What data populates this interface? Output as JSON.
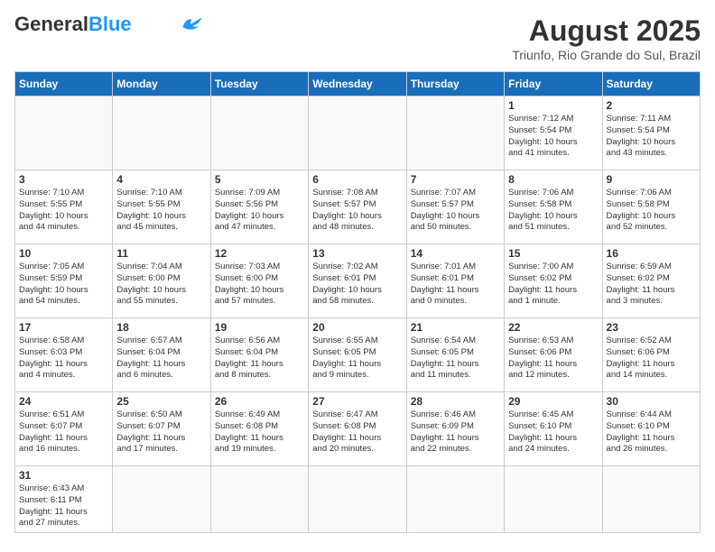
{
  "header": {
    "logo_general": "General",
    "logo_blue": "Blue",
    "month_year": "August 2025",
    "location": "Triunfo, Rio Grande do Sul, Brazil"
  },
  "days_of_week": [
    "Sunday",
    "Monday",
    "Tuesday",
    "Wednesday",
    "Thursday",
    "Friday",
    "Saturday"
  ],
  "weeks": [
    [
      {
        "day": "",
        "info": ""
      },
      {
        "day": "",
        "info": ""
      },
      {
        "day": "",
        "info": ""
      },
      {
        "day": "",
        "info": ""
      },
      {
        "day": "",
        "info": ""
      },
      {
        "day": "1",
        "info": "Sunrise: 7:12 AM\nSunset: 5:54 PM\nDaylight: 10 hours\nand 41 minutes."
      },
      {
        "day": "2",
        "info": "Sunrise: 7:11 AM\nSunset: 5:54 PM\nDaylight: 10 hours\nand 43 minutes."
      }
    ],
    [
      {
        "day": "3",
        "info": "Sunrise: 7:10 AM\nSunset: 5:55 PM\nDaylight: 10 hours\nand 44 minutes."
      },
      {
        "day": "4",
        "info": "Sunrise: 7:10 AM\nSunset: 5:55 PM\nDaylight: 10 hours\nand 45 minutes."
      },
      {
        "day": "5",
        "info": "Sunrise: 7:09 AM\nSunset: 5:56 PM\nDaylight: 10 hours\nand 47 minutes."
      },
      {
        "day": "6",
        "info": "Sunrise: 7:08 AM\nSunset: 5:57 PM\nDaylight: 10 hours\nand 48 minutes."
      },
      {
        "day": "7",
        "info": "Sunrise: 7:07 AM\nSunset: 5:57 PM\nDaylight: 10 hours\nand 50 minutes."
      },
      {
        "day": "8",
        "info": "Sunrise: 7:06 AM\nSunset: 5:58 PM\nDaylight: 10 hours\nand 51 minutes."
      },
      {
        "day": "9",
        "info": "Sunrise: 7:06 AM\nSunset: 5:58 PM\nDaylight: 10 hours\nand 52 minutes."
      }
    ],
    [
      {
        "day": "10",
        "info": "Sunrise: 7:05 AM\nSunset: 5:59 PM\nDaylight: 10 hours\nand 54 minutes."
      },
      {
        "day": "11",
        "info": "Sunrise: 7:04 AM\nSunset: 6:00 PM\nDaylight: 10 hours\nand 55 minutes."
      },
      {
        "day": "12",
        "info": "Sunrise: 7:03 AM\nSunset: 6:00 PM\nDaylight: 10 hours\nand 57 minutes."
      },
      {
        "day": "13",
        "info": "Sunrise: 7:02 AM\nSunset: 6:01 PM\nDaylight: 10 hours\nand 58 minutes."
      },
      {
        "day": "14",
        "info": "Sunrise: 7:01 AM\nSunset: 6:01 PM\nDaylight: 11 hours\nand 0 minutes."
      },
      {
        "day": "15",
        "info": "Sunrise: 7:00 AM\nSunset: 6:02 PM\nDaylight: 11 hours\nand 1 minute."
      },
      {
        "day": "16",
        "info": "Sunrise: 6:59 AM\nSunset: 6:02 PM\nDaylight: 11 hours\nand 3 minutes."
      }
    ],
    [
      {
        "day": "17",
        "info": "Sunrise: 6:58 AM\nSunset: 6:03 PM\nDaylight: 11 hours\nand 4 minutes."
      },
      {
        "day": "18",
        "info": "Sunrise: 6:57 AM\nSunset: 6:04 PM\nDaylight: 11 hours\nand 6 minutes."
      },
      {
        "day": "19",
        "info": "Sunrise: 6:56 AM\nSunset: 6:04 PM\nDaylight: 11 hours\nand 8 minutes."
      },
      {
        "day": "20",
        "info": "Sunrise: 6:55 AM\nSunset: 6:05 PM\nDaylight: 11 hours\nand 9 minutes."
      },
      {
        "day": "21",
        "info": "Sunrise: 6:54 AM\nSunset: 6:05 PM\nDaylight: 11 hours\nand 11 minutes."
      },
      {
        "day": "22",
        "info": "Sunrise: 6:53 AM\nSunset: 6:06 PM\nDaylight: 11 hours\nand 12 minutes."
      },
      {
        "day": "23",
        "info": "Sunrise: 6:52 AM\nSunset: 6:06 PM\nDaylight: 11 hours\nand 14 minutes."
      }
    ],
    [
      {
        "day": "24",
        "info": "Sunrise: 6:51 AM\nSunset: 6:07 PM\nDaylight: 11 hours\nand 16 minutes."
      },
      {
        "day": "25",
        "info": "Sunrise: 6:50 AM\nSunset: 6:07 PM\nDaylight: 11 hours\nand 17 minutes."
      },
      {
        "day": "26",
        "info": "Sunrise: 6:49 AM\nSunset: 6:08 PM\nDaylight: 11 hours\nand 19 minutes."
      },
      {
        "day": "27",
        "info": "Sunrise: 6:47 AM\nSunset: 6:08 PM\nDaylight: 11 hours\nand 20 minutes."
      },
      {
        "day": "28",
        "info": "Sunrise: 6:46 AM\nSunset: 6:09 PM\nDaylight: 11 hours\nand 22 minutes."
      },
      {
        "day": "29",
        "info": "Sunrise: 6:45 AM\nSunset: 6:10 PM\nDaylight: 11 hours\nand 24 minutes."
      },
      {
        "day": "30",
        "info": "Sunrise: 6:44 AM\nSunset: 6:10 PM\nDaylight: 11 hours\nand 26 minutes."
      }
    ],
    [
      {
        "day": "31",
        "info": "Sunrise: 6:43 AM\nSunset: 6:11 PM\nDaylight: 11 hours\nand 27 minutes."
      },
      {
        "day": "",
        "info": ""
      },
      {
        "day": "",
        "info": ""
      },
      {
        "day": "",
        "info": ""
      },
      {
        "day": "",
        "info": ""
      },
      {
        "day": "",
        "info": ""
      },
      {
        "day": "",
        "info": ""
      }
    ]
  ]
}
